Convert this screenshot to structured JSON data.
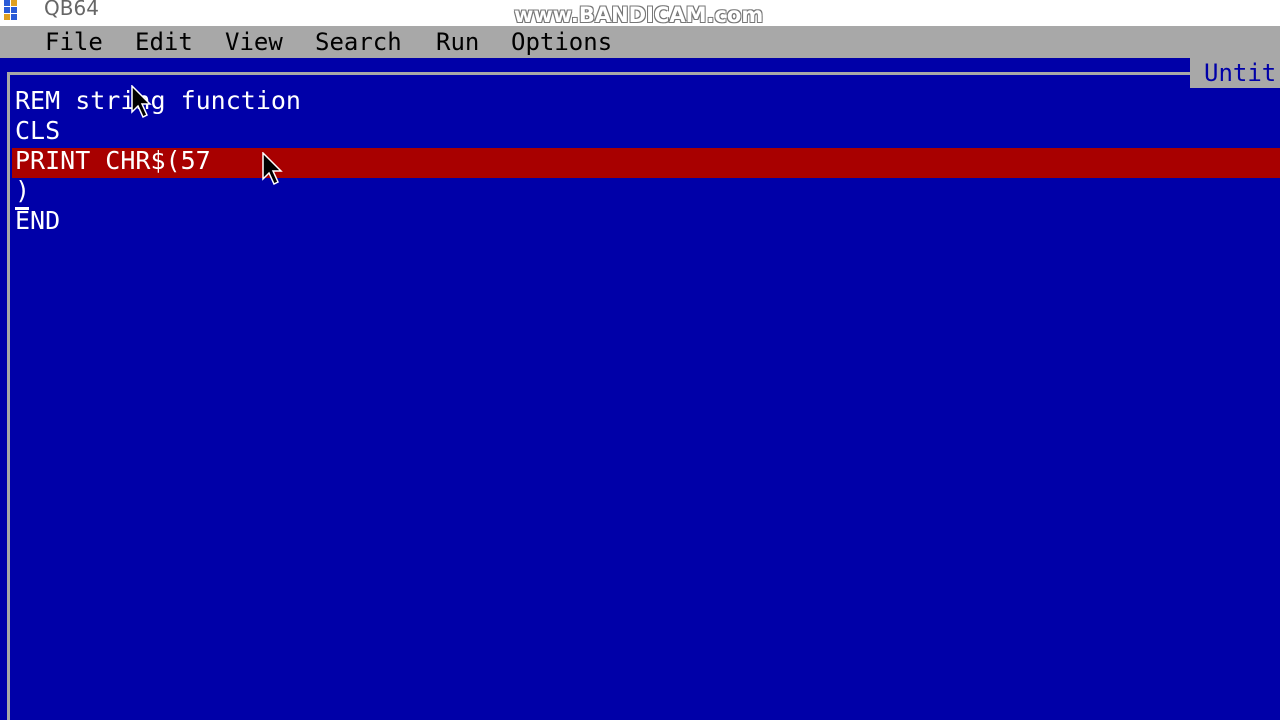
{
  "window": {
    "title": "QB64",
    "watermark": "www.BANDICAM.com"
  },
  "menubar": {
    "items": [
      {
        "label": "File"
      },
      {
        "label": "Edit"
      },
      {
        "label": "View"
      },
      {
        "label": "Search"
      },
      {
        "label": "Run"
      },
      {
        "label": "Options"
      }
    ]
  },
  "editor": {
    "file_tab": "Untit",
    "lines": [
      "REM string function",
      "CLS",
      "PRINT CHR$(57",
      ")",
      "END"
    ],
    "highlighted_line": 3
  },
  "colors": {
    "background": "#0000a8",
    "menubar": "#a8a8a8",
    "highlight": "#a80000",
    "text": "#ffffff"
  }
}
